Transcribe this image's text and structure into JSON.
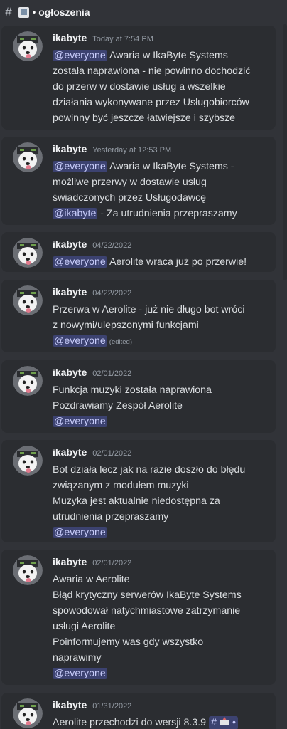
{
  "header": {
    "hash": "#",
    "dot": "•",
    "channel_name": "ogłoszenia"
  },
  "messages": [
    {
      "author": "ikabyte",
      "timestamp": "Today at 7:54 PM",
      "lines": [
        [
          {
            "t": "mention",
            "v": "@everyone"
          },
          {
            "t": "text",
            "v": " Awaria w IkaByte Systems"
          }
        ],
        [
          {
            "t": "text",
            "v": "została naprawiona - nie powinno dochodzić"
          }
        ],
        [
          {
            "t": "text",
            "v": "do przerw w dostawie usług a wszelkie"
          }
        ],
        [
          {
            "t": "text",
            "v": "działania wykonywane przez Usługobiorców"
          }
        ],
        [
          {
            "t": "text",
            "v": "powinny być jeszcze łatwiejsze i szybsze"
          }
        ]
      ]
    },
    {
      "author": "ikabyte",
      "timestamp": "Yesterday at 12:53 PM",
      "lines": [
        [
          {
            "t": "mention",
            "v": "@everyone"
          },
          {
            "t": "text",
            "v": " Awaria w IkaByte Systems -"
          }
        ],
        [
          {
            "t": "text",
            "v": "możliwe przerwy w dostawie usług"
          }
        ],
        [
          {
            "t": "text",
            "v": "świadczonych przez Usługodawcę"
          }
        ],
        [
          {
            "t": "mention",
            "v": "@ikabyte"
          },
          {
            "t": "text",
            "v": " - Za utrudnienia przepraszamy"
          }
        ]
      ]
    },
    {
      "author": "ikabyte",
      "timestamp": "04/22/2022",
      "lines": [
        [
          {
            "t": "mention",
            "v": "@everyone"
          },
          {
            "t": "text",
            "v": " Aerolite wraca już po przerwie!"
          }
        ]
      ]
    },
    {
      "author": "ikabyte",
      "timestamp": "04/22/2022",
      "lines": [
        [
          {
            "t": "text",
            "v": "Przerwa w Aerolite - już nie długo bot wróci"
          }
        ],
        [
          {
            "t": "text",
            "v": "z nowymi/ulepszonymi funkcjami"
          }
        ],
        [
          {
            "t": "mention",
            "v": "@everyone"
          },
          {
            "t": "edited",
            "v": "(edited)"
          }
        ]
      ]
    },
    {
      "author": "ikabyte",
      "timestamp": "02/01/2022",
      "lines": [
        [
          {
            "t": "text",
            "v": "Funkcja muzyki została naprawiona"
          }
        ],
        [
          {
            "t": "text",
            "v": "Pozdrawiamy Zespół Aerolite"
          }
        ],
        [
          {
            "t": "mention",
            "v": "@everyone"
          }
        ]
      ]
    },
    {
      "author": "ikabyte",
      "timestamp": "02/01/2022",
      "lines": [
        [
          {
            "t": "text",
            "v": "Bot działa lecz jak na razie doszło do błędu"
          }
        ],
        [
          {
            "t": "text",
            "v": "związanym z modułem muzyki"
          }
        ],
        [
          {
            "t": "text",
            "v": "Muzyka jest aktualnie niedostępna za"
          }
        ],
        [
          {
            "t": "text",
            "v": "utrudnienia przepraszamy"
          }
        ],
        [
          {
            "t": "mention",
            "v": "@everyone"
          }
        ]
      ]
    },
    {
      "author": "ikabyte",
      "timestamp": "02/01/2022",
      "lines": [
        [
          {
            "t": "text",
            "v": "Awaria w Aerolite"
          }
        ],
        [
          {
            "t": "text",
            "v": "Błąd krytyczny serwerów IkaByte Systems"
          }
        ],
        [
          {
            "t": "text",
            "v": "spowodował natychmiastowe zatrzymanie"
          }
        ],
        [
          {
            "t": "text",
            "v": "usługi Aerolite"
          }
        ],
        [
          {
            "t": "text",
            "v": "Poinformujemy was gdy wszystko"
          }
        ],
        [
          {
            "t": "text",
            "v": "naprawimy"
          }
        ],
        [
          {
            "t": "mention",
            "v": "@everyone"
          }
        ]
      ]
    },
    {
      "author": "ikabyte",
      "timestamp": "01/31/2022",
      "lines": [
        [
          {
            "t": "text",
            "v": "Aerolite przechodzi do wersji 8.3.9"
          },
          {
            "t": "channel",
            "v": "•"
          }
        ]
      ]
    }
  ],
  "colors": {
    "background": "#313338",
    "message_card": "#2b2d31",
    "mention_bg": "#3c4270",
    "mention_fg": "#c9cdfb"
  }
}
